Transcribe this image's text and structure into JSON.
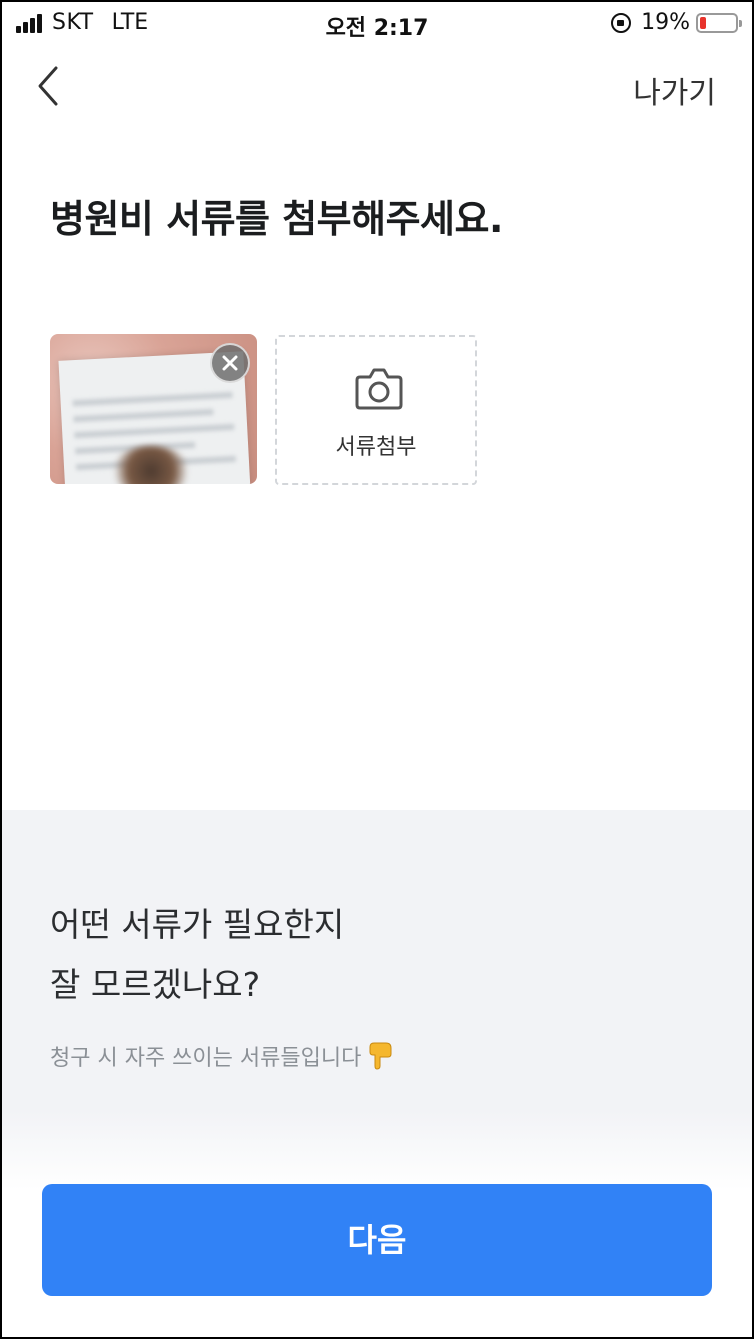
{
  "status_bar": {
    "carrier": "SKT",
    "network": "LTE",
    "time": "오전 2:17",
    "battery": "19%"
  },
  "nav": {
    "exit_label": "나가기"
  },
  "page": {
    "title": "병원비 서류를 첨부해주세요."
  },
  "attachments": {
    "add_label": "서류첨부"
  },
  "help": {
    "question_line1": "어떤 서류가 필요한지",
    "question_line2": "잘 모르겠나요?",
    "hint": "청구 시 자주 쓰이는 서류들입니다"
  },
  "footer": {
    "next_label": "다음"
  },
  "colors": {
    "primary": "#3182f6",
    "help_bg": "#f2f3f6",
    "battery_low": "#e8332c"
  },
  "icons": [
    "signal-icon",
    "rotation-lock-icon",
    "battery-icon",
    "chevron-left-icon",
    "close-icon",
    "camera-icon",
    "point-down-icon"
  ]
}
